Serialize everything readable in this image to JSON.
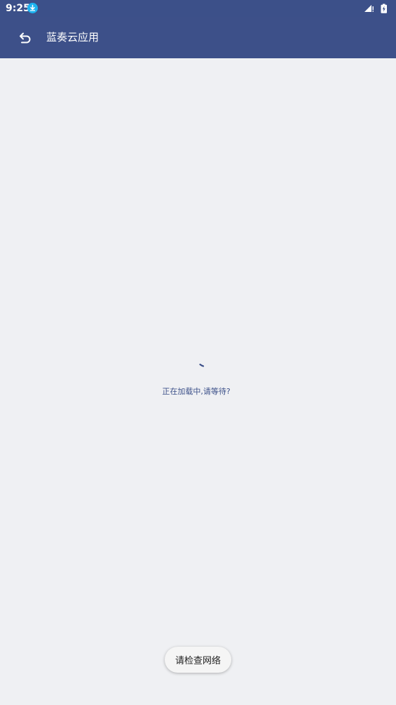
{
  "status_bar": {
    "time": "9:25",
    "download_icon": "download-icon",
    "signal_icon": "signal-icon",
    "battery_icon": "battery-charging-icon"
  },
  "app_bar": {
    "back_icon": "back-arrow-icon",
    "title": "蓝奏云应用"
  },
  "main": {
    "spinner_icon": "loading-spinner-icon",
    "loading_text": "正在加载中,请等待?"
  },
  "toast": {
    "message": "请检查网络"
  },
  "colors": {
    "primary": "#3d5089",
    "background": "#eff0f3",
    "download_badge": "#1db3f0",
    "toast_bg": "#f5f5f5"
  }
}
